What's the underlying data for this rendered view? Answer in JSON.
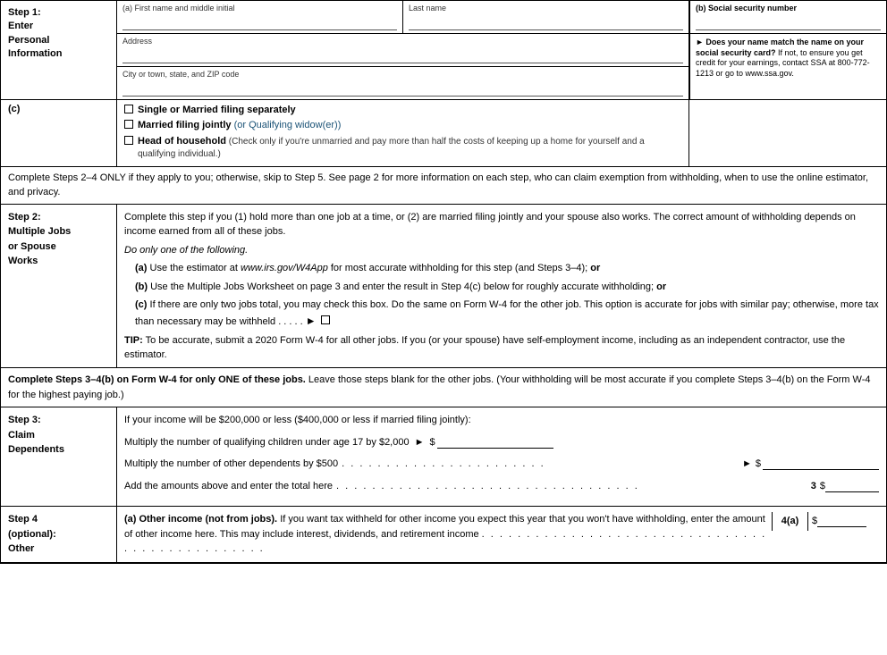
{
  "form": {
    "step1": {
      "label_step": "Step 1:",
      "label_enter": "Enter",
      "label_personal": "Personal",
      "label_information": "Information",
      "field_a_label": "(a) First name and middle initial",
      "field_last_label": "Last name",
      "field_ssn_label": "(b) Social security number",
      "field_address_label": "Address",
      "field_city_label": "City or town, state, and ZIP code",
      "ssn_match_title": "► Does your name match the name on your social security card?",
      "ssn_match_body": " If not, to ensure you get credit for your earnings, contact SSA at 800-772-1213 or go to www.ssa.gov.",
      "filing_label": "(c)",
      "options": [
        {
          "text_bold": "Single or Married filing separately",
          "text_normal": ""
        },
        {
          "text_bold": "Married filing jointly",
          "text_normal": " (or Qualifying widow(er))",
          "link": true
        },
        {
          "text_bold": "Head of household",
          "text_normal": " (Check only if you're unmarried and pay more than half the costs of keeping up a home for yourself and a qualifying individual.)"
        }
      ]
    },
    "instructions_banner": "Complete Steps 2–4 ONLY if they apply to you; otherwise, skip to Step 5. See page 2 for more information on each step, who can claim exemption from withholding, when to use the online estimator, and privacy.",
    "step2": {
      "label_step": "Step 2:",
      "label_line2": "Multiple Jobs",
      "label_line3": "or Spouse",
      "label_line4": "Works",
      "intro": "Complete this step if you (1) hold more than one job at a time, or (2) are married filing jointly and your spouse also works. The correct amount of withholding depends on income earned from all of these jobs.",
      "do_one": "Do only one of the following.",
      "option_a": "(a) Use the estimator at www.irs.gov/W4App for most accurate withholding for this step (and Steps 3–4); or",
      "option_b": "(b) Use the Multiple Jobs Worksheet on page 3 and enter the result in Step 4(c) below for roughly accurate withholding; or",
      "option_c_pre": "(c) If there are only two jobs total, you may check this box. Do the same on Form W-4 for the other job. This option is accurate for jobs with similar pay; otherwise, more tax than necessary may be withheld . . . . .",
      "option_c_arrow": "►",
      "tip": "TIP: To be accurate, submit a 2020 Form W-4 for all other jobs. If you (or your spouse) have self-employment income, including as an independent contractor, use the estimator."
    },
    "complete_steps_banner": "Complete Steps 3–4(b) on Form W-4 for only ONE of these jobs. Leave those steps blank for the other jobs. (Your withholding will be most accurate if you complete Steps 3–4(b) on the Form W-4 for the highest paying job.)",
    "step3": {
      "label_step": "Step 3:",
      "label_line2": "Claim",
      "label_line3": "Dependents",
      "income_condition": "If your income will be $200,000 or less ($400,000 or less if married filing jointly):",
      "row1_text": "Multiply the number of qualifying children under age 17 by $2,000",
      "row1_dots": ". . . . . . . . . . . . . . . . . . . . . . . . . . . . . . . . . . .",
      "row1_arrow": "►",
      "row1_dollar": "$",
      "row2_text": "Multiply the number of other dependents by $500",
      "row2_dots": ". . . . . . . . . . . . . . . . . . . . . . . . . . . . . . . . . . . . . . . . .",
      "row2_arrow": "►",
      "row2_dollar": "$",
      "total_text": "Add the amounts above and enter the total here",
      "total_dots": ". . . . . . . . . . . . . . . . . . . . . . . . . . . . . . . .",
      "total_num": "3",
      "total_dollar": "$"
    },
    "step4": {
      "label_step": "Step 4",
      "label_line2": "(optional):",
      "label_line3": "Other",
      "option_a_label": "(a)",
      "option_a_title": "Other income (not from jobs).",
      "option_a_text": " If you want tax withheld for other income you expect this year that you won't have withholding, enter the amount of other income here. This may include interest, dividends, and retirement income",
      "option_a_dots": ". . . . . . . . . . . . . . . . . . . . . . . . . . . . . . . . . . . . . . . . . . . . . .",
      "option_a_num": "4(a)",
      "option_a_dollar": "$"
    }
  }
}
